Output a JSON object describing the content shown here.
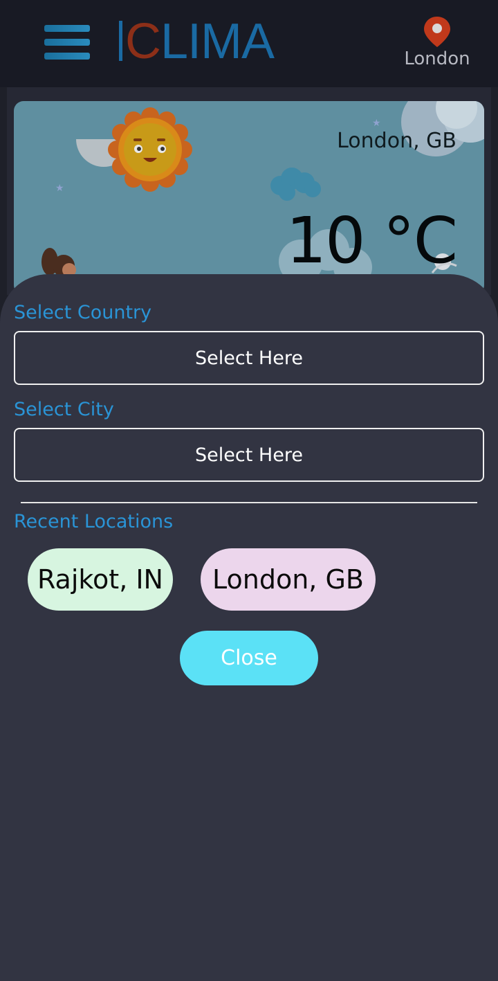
{
  "header": {
    "menu_icon": "hamburger-menu-icon",
    "logo": {
      "letter_i": "I",
      "letter_c": "C",
      "rest": "LIMA"
    },
    "location_icon": "map-pin-icon",
    "location_label": "London",
    "colors": {
      "logo_blue": "#1a6aa3",
      "logo_red": "#8c2f18",
      "pin": "#c0391b"
    }
  },
  "weather_card": {
    "city": "London, GB",
    "temperature": "10 °C"
  },
  "sheet": {
    "country_label": "Select Country",
    "country_placeholder": "Select Here",
    "city_label": "Select City",
    "city_placeholder": "Select Here",
    "recent_label": "Recent Locations",
    "recent_locations": [
      {
        "label": "Rajkot, IN",
        "color": "#d7f5e0"
      },
      {
        "label": "London, GB",
        "color": "#ecd6ec"
      }
    ],
    "close_label": "Close",
    "colors": {
      "accent": "#2a94d6",
      "close_button": "#5be1f6",
      "sheet_bg": "#323442"
    }
  }
}
